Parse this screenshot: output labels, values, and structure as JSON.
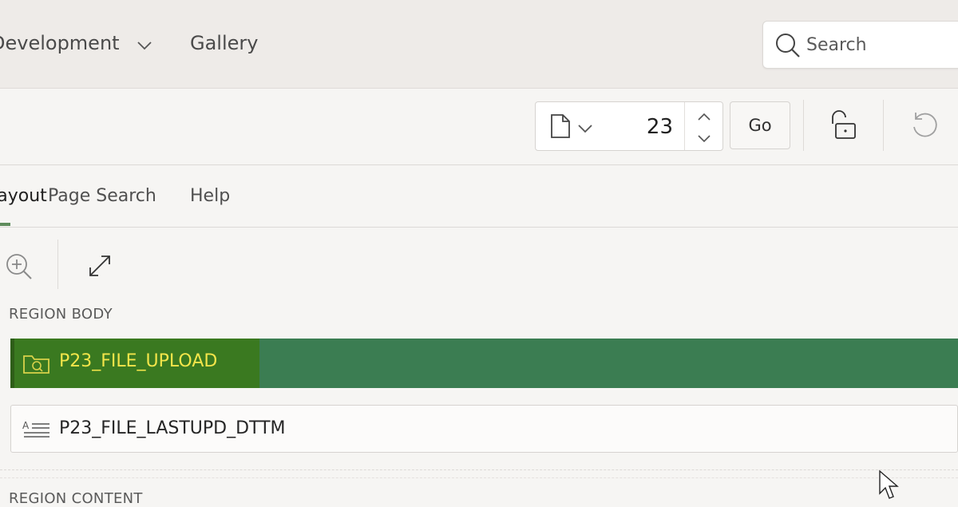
{
  "nav": {
    "development_label": "Development",
    "gallery_label": "Gallery"
  },
  "search": {
    "placeholder": "Search"
  },
  "toolbar": {
    "page_number": "23",
    "go_label": "Go"
  },
  "tabs": [
    {
      "label": "Layout",
      "active": true
    },
    {
      "label": "Page Search"
    },
    {
      "label": "Help"
    }
  ],
  "layout": {
    "region_body_label": "REGION BODY",
    "region_content_label": "REGION CONTENT",
    "items": [
      {
        "name": "P23_FILE_UPLOAD",
        "icon": "file-browse-icon",
        "selected": true
      },
      {
        "name": "P23_FILE_LASTUPD_DTTM",
        "icon": "text-field-icon",
        "selected": false
      }
    ]
  },
  "colors": {
    "selected_item_bg": "#3a7920",
    "selected_item_text": "#f3e54a",
    "region_row_bg": "#3b7d52",
    "active_tab_indicator": "#5f8c5c"
  }
}
